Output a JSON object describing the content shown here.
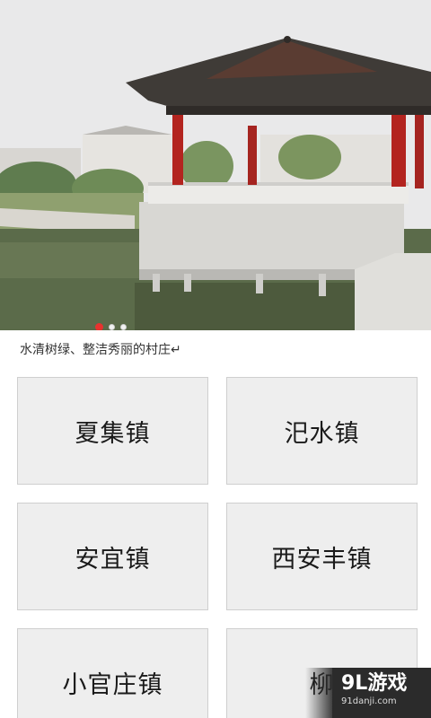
{
  "banner": {
    "image_description_icon": "pavilion-landscape-photo",
    "slides_total": 3,
    "active_slide": 1,
    "caption": "水清树绿、整洁秀丽的村庄↵"
  },
  "towns": [
    {
      "label": "夏集镇"
    },
    {
      "label": "汜水镇"
    },
    {
      "label": "安宜镇"
    },
    {
      "label": "西安丰镇"
    },
    {
      "label": "小官庄镇"
    },
    {
      "label": "柳"
    }
  ],
  "watermark": {
    "logo": "9L游戏",
    "url": "91danji.com"
  },
  "colors": {
    "tile_bg": "#eeeeee",
    "tile_border": "#cfcfcf",
    "active_dot": "#e8322f",
    "watermark_bg": "#2b2b2b"
  }
}
